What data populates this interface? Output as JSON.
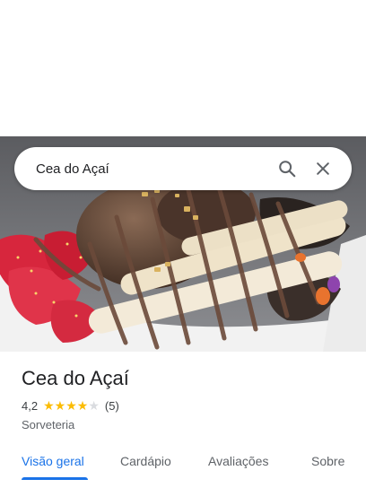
{
  "search": {
    "query": "Cea do Açaí",
    "search_icon": "search-icon",
    "close_icon": "close-icon"
  },
  "place": {
    "name": "Cea do Açaí",
    "rating": "4,2",
    "stars_filled": 4,
    "stars_total": 5,
    "review_count": "(5)",
    "category": "Sorveteria"
  },
  "tabs": [
    {
      "label": "Visão geral",
      "active": true
    },
    {
      "label": "Cardápio",
      "active": false
    },
    {
      "label": "Avaliações",
      "active": false
    },
    {
      "label": "Sobre",
      "active": false
    }
  ],
  "colors": {
    "accent": "#1a73e8",
    "star": "#fbbc04",
    "star_empty": "#dadce0"
  }
}
